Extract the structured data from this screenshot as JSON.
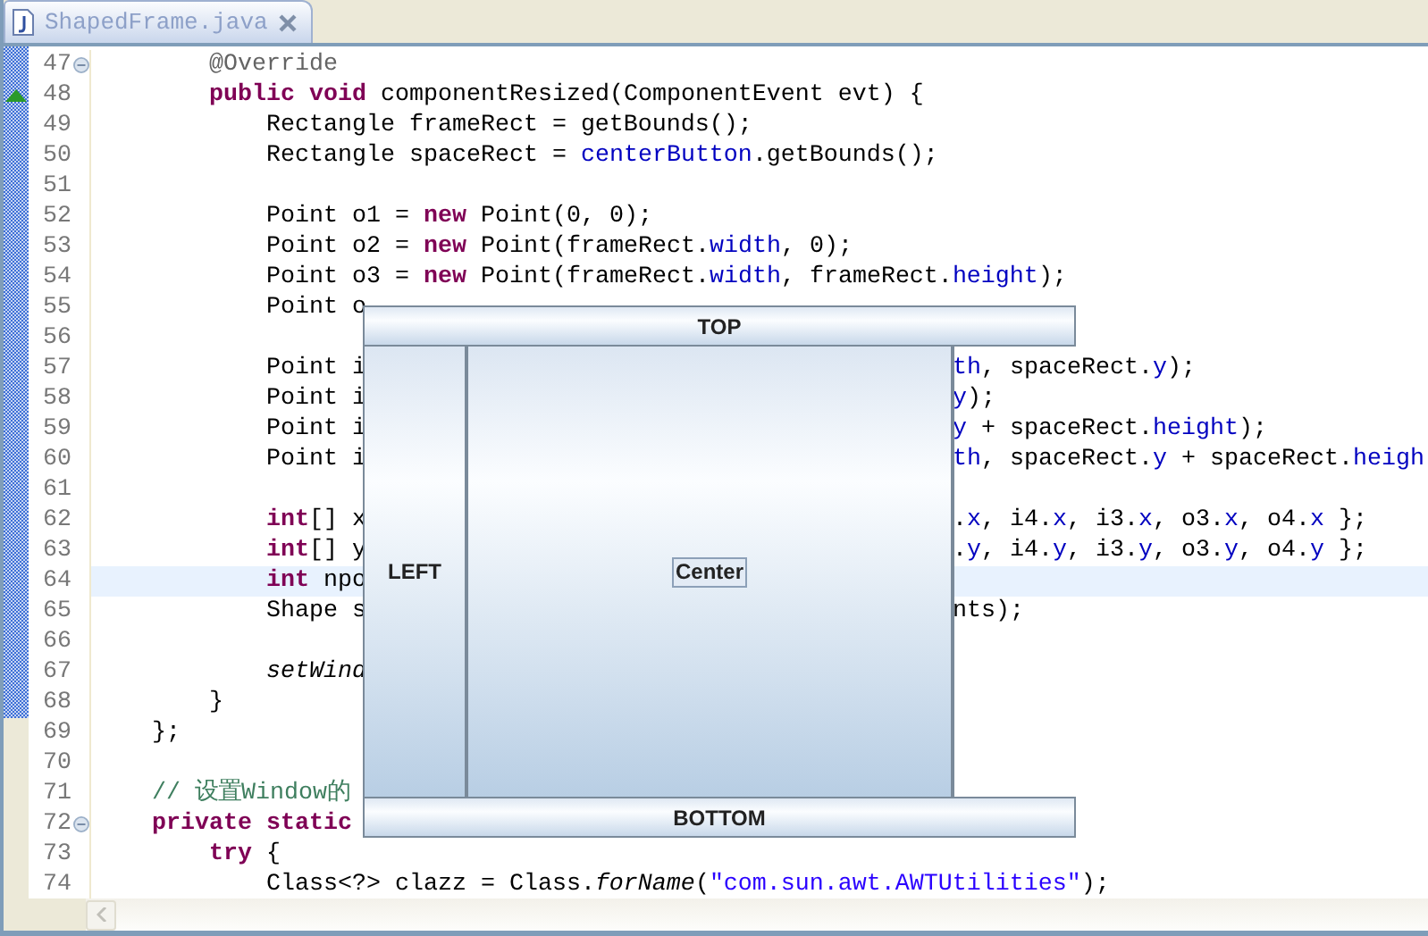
{
  "tab": {
    "title": "ShapedFrame.java",
    "selected": true
  },
  "lines": [
    {
      "number": "47",
      "fold": true,
      "override": false,
      "current": false,
      "left": [
        {
          "annotation": "        @Override"
        }
      ]
    },
    {
      "number": "48",
      "fold": false,
      "override": true,
      "current": false,
      "left": [
        {
          "keyword": "        public "
        },
        {
          "keyword": "void"
        },
        {
          "code": " componentResized(ComponentEvent evt) {"
        }
      ]
    },
    {
      "number": "49",
      "fold": false,
      "override": false,
      "current": false,
      "left": [
        {
          "code": "            Rectangle frameRect = getBounds();"
        }
      ]
    },
    {
      "number": "50",
      "fold": false,
      "override": false,
      "current": false,
      "left": [
        {
          "code": "            Rectangle spaceRect = "
        },
        {
          "field": "centerButton"
        },
        {
          "code": ".getBounds();"
        }
      ]
    },
    {
      "number": "51",
      "fold": false,
      "override": false,
      "current": false
    },
    {
      "number": "52",
      "fold": false,
      "override": false,
      "current": false,
      "left": [
        {
          "code": "            Point o1 = "
        },
        {
          "keyword": "new"
        },
        {
          "code": " Point(0, 0);"
        }
      ]
    },
    {
      "number": "53",
      "fold": false,
      "override": false,
      "current": false,
      "left": [
        {
          "code": "            Point o2 = "
        },
        {
          "keyword": "new"
        },
        {
          "code": " Point(frameRect."
        },
        {
          "field": "width"
        },
        {
          "code": ", 0);"
        }
      ]
    },
    {
      "number": "54",
      "fold": false,
      "override": false,
      "current": false,
      "left": [
        {
          "code": "            Point o3 = "
        },
        {
          "keyword": "new"
        },
        {
          "code": " Point(frameRect."
        },
        {
          "field": "width"
        },
        {
          "code": ", frameRect."
        },
        {
          "field": "height"
        },
        {
          "code": ");"
        }
      ]
    },
    {
      "number": "55",
      "fold": false,
      "override": false,
      "current": false,
      "left": [
        {
          "code": "            Point o"
        }
      ]
    },
    {
      "number": "56",
      "fold": false,
      "override": false,
      "current": false
    },
    {
      "number": "57",
      "fold": false,
      "override": false,
      "current": false,
      "left": [
        {
          "code": "            Point i"
        }
      ],
      "right": [
        {
          "field": "th"
        },
        {
          "code": ", spaceRect."
        },
        {
          "field": "y"
        },
        {
          "code": ");"
        }
      ]
    },
    {
      "number": "58",
      "fold": false,
      "override": false,
      "current": false,
      "left": [
        {
          "code": "            Point i"
        }
      ],
      "right": [
        {
          "field": "y"
        },
        {
          "code": ");"
        }
      ]
    },
    {
      "number": "59",
      "fold": false,
      "override": false,
      "current": false,
      "left": [
        {
          "code": "            Point i"
        }
      ],
      "right": [
        {
          "field": "y"
        },
        {
          "code": " + spaceRect."
        },
        {
          "field": "height"
        },
        {
          "code": ");"
        }
      ]
    },
    {
      "number": "60",
      "fold": false,
      "override": false,
      "current": false,
      "left": [
        {
          "code": "            Point i"
        }
      ],
      "right": [
        {
          "field": "th"
        },
        {
          "code": ", spaceRect."
        },
        {
          "field": "y"
        },
        {
          "code": " + spaceRect."
        },
        {
          "field": "heigh"
        }
      ]
    },
    {
      "number": "61",
      "fold": false,
      "override": false,
      "current": false
    },
    {
      "number": "62",
      "fold": false,
      "override": false,
      "current": false,
      "left": [
        {
          "keyword": "            int"
        },
        {
          "code": "[] x"
        }
      ],
      "right": [
        {
          "code": "."
        },
        {
          "field": "x"
        },
        {
          "code": ", i4."
        },
        {
          "field": "x"
        },
        {
          "code": ", i3."
        },
        {
          "field": "x"
        },
        {
          "code": ", o3."
        },
        {
          "field": "x"
        },
        {
          "code": ", o4."
        },
        {
          "field": "x"
        },
        {
          "code": " };"
        }
      ]
    },
    {
      "number": "63",
      "fold": false,
      "override": false,
      "current": false,
      "left": [
        {
          "keyword": "            int"
        },
        {
          "code": "[] y"
        }
      ],
      "right": [
        {
          "code": "."
        },
        {
          "field": "y"
        },
        {
          "code": ", i4."
        },
        {
          "field": "y"
        },
        {
          "code": ", i3."
        },
        {
          "field": "y"
        },
        {
          "code": ", o3."
        },
        {
          "field": "y"
        },
        {
          "code": ", o4."
        },
        {
          "field": "y"
        },
        {
          "code": " };"
        }
      ]
    },
    {
      "number": "64",
      "fold": false,
      "override": false,
      "current": true,
      "left": [
        {
          "keyword": "            int"
        },
        {
          "code": " npo"
        }
      ]
    },
    {
      "number": "65",
      "fold": false,
      "override": false,
      "current": false,
      "left": [
        {
          "code": "            Shape s"
        }
      ],
      "right": [
        {
          "code": "nts);"
        }
      ]
    },
    {
      "number": "66",
      "fold": false,
      "override": false,
      "current": false
    },
    {
      "number": "67",
      "fold": false,
      "override": false,
      "current": false,
      "left": [
        {
          "static": "            setWind"
        }
      ]
    },
    {
      "number": "68",
      "fold": false,
      "override": false,
      "current": false,
      "left": [
        {
          "code": "        }"
        }
      ]
    },
    {
      "number": "69",
      "fold": false,
      "override": false,
      "current": false,
      "left": [
        {
          "code": "    };"
        }
      ]
    },
    {
      "number": "70",
      "fold": false,
      "override": false,
      "current": false
    },
    {
      "number": "71",
      "fold": false,
      "override": false,
      "current": false,
      "left": [
        {
          "comment": "    // 设置Window的"
        }
      ]
    },
    {
      "number": "72",
      "fold": true,
      "override": false,
      "current": false,
      "left": [
        {
          "keyword": "    private "
        },
        {
          "keyword": "static"
        }
      ]
    },
    {
      "number": "73",
      "fold": false,
      "override": false,
      "current": false,
      "left": [
        {
          "keyword": "        try"
        },
        {
          "code": " {"
        }
      ]
    },
    {
      "number": "74",
      "fold": false,
      "override": false,
      "current": false,
      "left": [
        {
          "code": "            Class<?> clazz = Class."
        },
        {
          "static": "forName"
        },
        {
          "code": "("
        },
        {
          "string": "\"com.sun.awt.AWTUtilities\""
        },
        {
          "code": ");"
        }
      ]
    }
  ],
  "window": {
    "top": "TOP",
    "left": "LEFT",
    "center": "Center",
    "bottom": "BOTTOM"
  }
}
